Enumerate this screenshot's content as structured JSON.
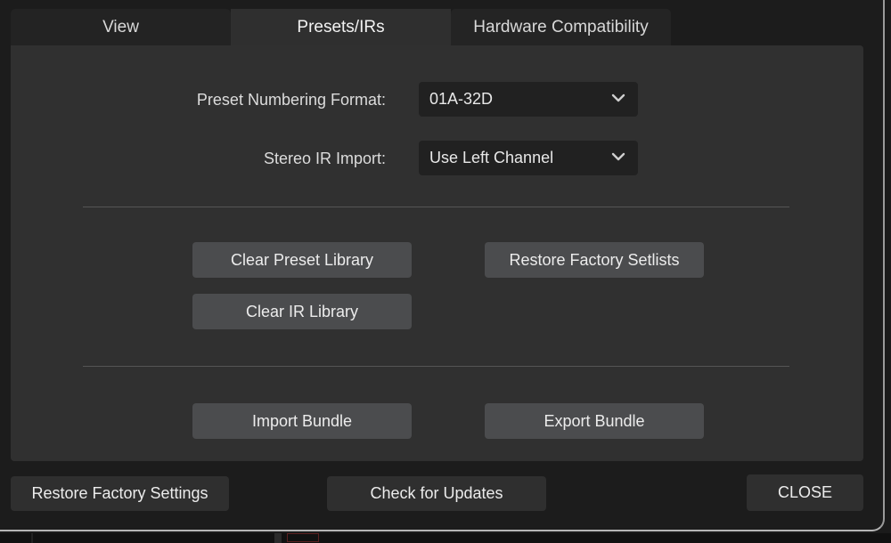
{
  "tabs": [
    {
      "label": "View",
      "active": false
    },
    {
      "label": "Presets/IRs",
      "active": true
    },
    {
      "label": "Hardware Compatibility",
      "active": false
    }
  ],
  "settings": {
    "preset_numbering": {
      "label": "Preset Numbering Format:",
      "value": "01A-32D",
      "icon": "chevron-down-icon"
    },
    "stereo_ir_import": {
      "label": "Stereo IR Import:",
      "value": "Use Left Channel",
      "icon": "chevron-down-icon"
    }
  },
  "library_buttons": {
    "clear_preset_library": "Clear Preset Library",
    "restore_factory_setlists": "Restore Factory Setlists",
    "clear_ir_library": "Clear IR Library"
  },
  "bundle_buttons": {
    "import_bundle": "Import Bundle",
    "export_bundle": "Export Bundle"
  },
  "footer": {
    "restore_factory_settings": "Restore Factory Settings",
    "check_for_updates": "Check for Updates",
    "close": "CLOSE"
  },
  "colors": {
    "background": "#1b1b1b",
    "panel": "#303030",
    "active_tab": "#2f2f2f",
    "inactive_tab": "#232323",
    "dropdown": "#212121",
    "button": "#4b4c4e",
    "footer_button": "#2f2f2f",
    "text": "#e4e4e4"
  }
}
